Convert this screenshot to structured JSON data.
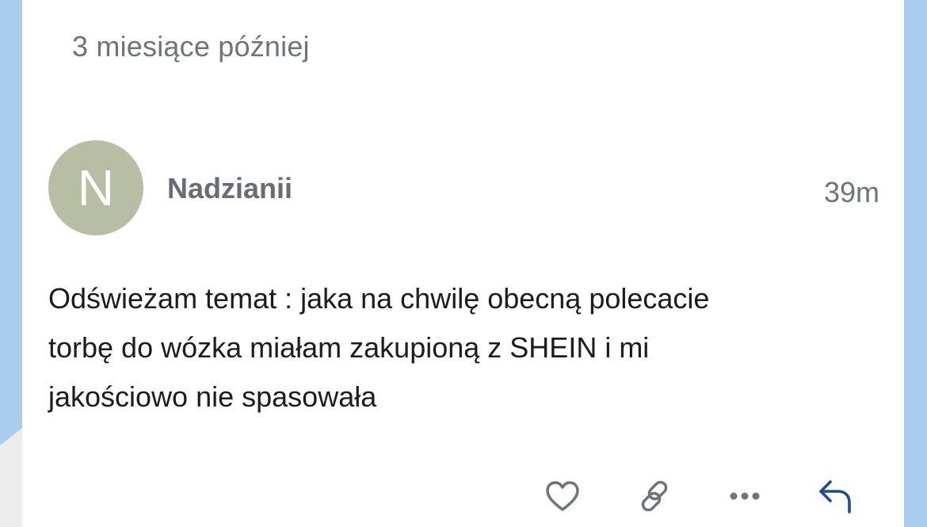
{
  "thread": {
    "time_divider": "3 miesiące później"
  },
  "post": {
    "avatar_letter": "N",
    "avatar_color": "#b8bea3",
    "username": "Nadzianii",
    "timestamp": "39m",
    "body_lines": [
      "Odświeżam temat : jaka na chwilę obecną polecacie",
      "torbę do wózka miałam zakupioną z SHEIN i mi",
      "jakościowo nie spasowała"
    ]
  },
  "actions": [
    {
      "name": "like-button",
      "icon": "heart-icon"
    },
    {
      "name": "share-link-button",
      "icon": "link-icon"
    },
    {
      "name": "more-options-button",
      "icon": "more-horizontal-icon"
    },
    {
      "name": "reply-button",
      "icon": "reply-icon"
    }
  ],
  "colors": {
    "page_background": "#a9cdef",
    "card_background": "#ffffff",
    "muted_text": "#6f7478",
    "username_text": "#676d73",
    "body_text": "#1a1c1e",
    "action_icon": "#6f7478",
    "reply_icon": "#1d4e89"
  }
}
